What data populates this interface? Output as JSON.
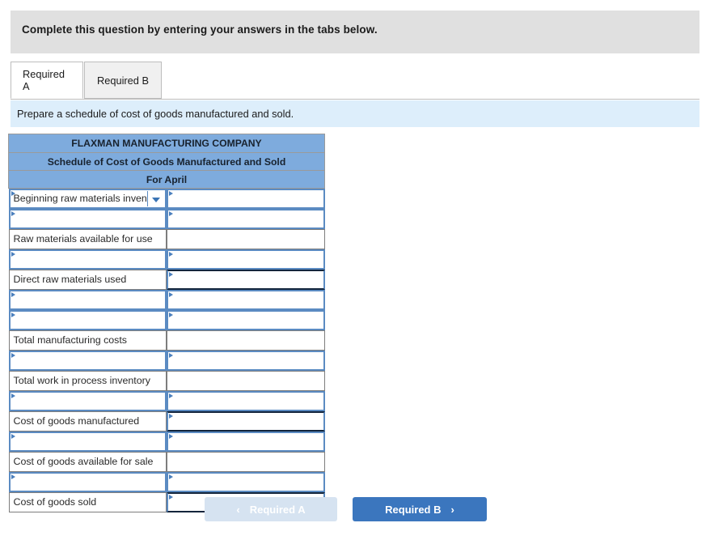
{
  "banner": {
    "text": "Complete this question by entering your answers in the tabs below."
  },
  "tabs": [
    {
      "label": "Required A",
      "active": true
    },
    {
      "label": "Required B",
      "active": false
    }
  ],
  "requirement": {
    "text": "Prepare a schedule of cost of goods manufactured and sold."
  },
  "sheet": {
    "header": [
      "FLAXMAN MANUFACTURING COMPANY",
      "Schedule of Cost of Goods Manufactured and Sold",
      "For April"
    ],
    "rows": [
      {
        "label": "Beginning raw materials inventory",
        "label_style": "select",
        "value": "",
        "value_style": "input"
      },
      {
        "label": "",
        "label_style": "input",
        "value": "",
        "value_style": "input"
      },
      {
        "label": "Raw materials available for use",
        "label_style": "plain",
        "value": "",
        "value_style": "plain"
      },
      {
        "label": "",
        "label_style": "input",
        "value": "",
        "value_style": "input"
      },
      {
        "label": "Direct raw materials used",
        "label_style": "plain",
        "value": "",
        "value_style": "input-ruled"
      },
      {
        "label": "",
        "label_style": "input",
        "value": "",
        "value_style": "input"
      },
      {
        "label": "",
        "label_style": "input",
        "value": "",
        "value_style": "input"
      },
      {
        "label": "Total manufacturing costs",
        "label_style": "plain",
        "value": "",
        "value_style": "plain"
      },
      {
        "label": "",
        "label_style": "input",
        "value": "",
        "value_style": "input"
      },
      {
        "label": "Total work in process inventory",
        "label_style": "plain",
        "value": "",
        "value_style": "plain"
      },
      {
        "label": "",
        "label_style": "input",
        "value": "",
        "value_style": "input"
      },
      {
        "label": "Cost of goods manufactured",
        "label_style": "plain",
        "value": "",
        "value_style": "input-ruled"
      },
      {
        "label": "",
        "label_style": "input",
        "value": "",
        "value_style": "input"
      },
      {
        "label": "Cost of goods available for sale",
        "label_style": "plain",
        "value": "",
        "value_style": "plain"
      },
      {
        "label": "",
        "label_style": "input",
        "value": "",
        "value_style": "input"
      },
      {
        "label": "Cost of goods sold",
        "label_style": "plain",
        "value": "",
        "value_style": "input-ruled"
      }
    ]
  },
  "footer": {
    "prev_label": "Required A",
    "prev_chevron": "‹",
    "next_label": "Required B",
    "next_chevron": "›"
  },
  "colors": {
    "header_blue": "#7eabdd",
    "input_border": "#5b8bc2",
    "banner_gray": "#e0e0e0",
    "requirement_blue": "#ddeefb",
    "next_button": "#3b76be",
    "prev_button": "#d6e3f1"
  }
}
